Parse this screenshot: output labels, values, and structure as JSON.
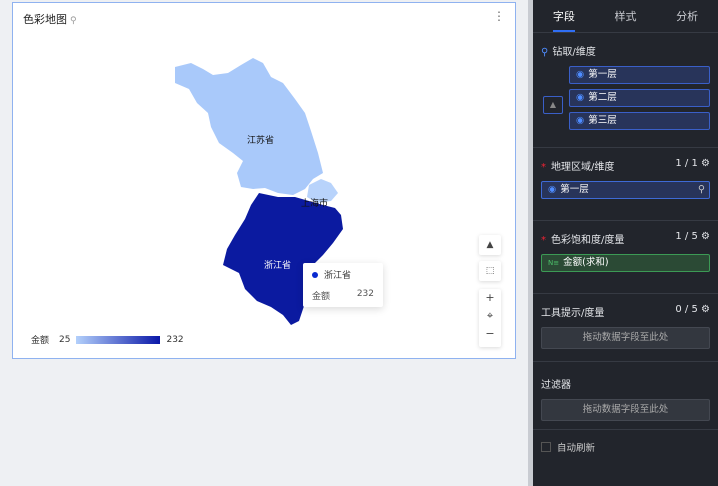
{
  "chart": {
    "title": "色彩地图",
    "more": "⋮"
  },
  "map": {
    "regions": [
      {
        "name": "江苏省",
        "color": "#a9c9fa"
      },
      {
        "name": "上海市",
        "color": "#b8d3fb"
      },
      {
        "name": "浙江省",
        "color": "#0b1aa0"
      }
    ]
  },
  "tooltip": {
    "name": "浙江省",
    "metric": "金额",
    "value": "232"
  },
  "legend": {
    "label": "金额",
    "min": "25",
    "max": "232"
  },
  "tools": {
    "warn": "▲",
    "select": "⬚",
    "zoom_in": "+",
    "locate": "⌖",
    "zoom_out": "−"
  },
  "panel": {
    "tabs": [
      "字段",
      "样式",
      "分析"
    ],
    "drill": {
      "title": "钻取/维度",
      "items": [
        "第一层",
        "第二层",
        "第三层"
      ]
    },
    "geo": {
      "title": "地理区域/维度",
      "count": "1 / 1",
      "item": "第一层"
    },
    "color": {
      "title": "色彩饱和度/度量",
      "count": "1 / 5",
      "item": "金额(求和)",
      "badge": "N≡"
    },
    "tooltip": {
      "title": "工具提示/度量",
      "count": "0 / 5",
      "drop": "拖动数据字段至此处"
    },
    "filter": {
      "title": "过滤器",
      "drop": "拖动数据字段至此处"
    },
    "refresh": "自动刷新"
  }
}
